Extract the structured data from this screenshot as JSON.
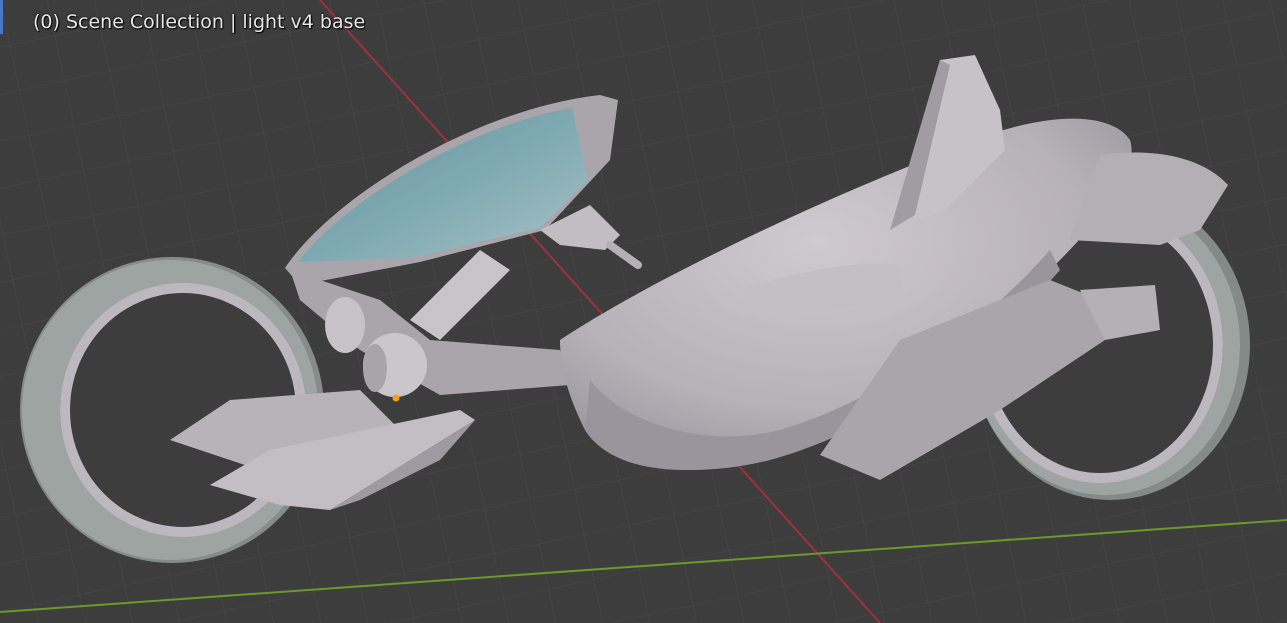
{
  "viewport": {
    "overlay_text": "(0) Scene Collection | light v4 base",
    "background_color": "#3d3d3d",
    "grid_color": "#4a4a4a",
    "x_axis_color": "#a0303b",
    "y_axis_color": "#6a9a2a",
    "active_marker_color": "#4a78c8"
  },
  "model": {
    "body_color": "#b9b4ba",
    "shadow_color": "#8e8a90",
    "tire_color": "#9da4a1",
    "canopy_color": "#6f9fa8",
    "origin_color": "#ff9a1f"
  }
}
